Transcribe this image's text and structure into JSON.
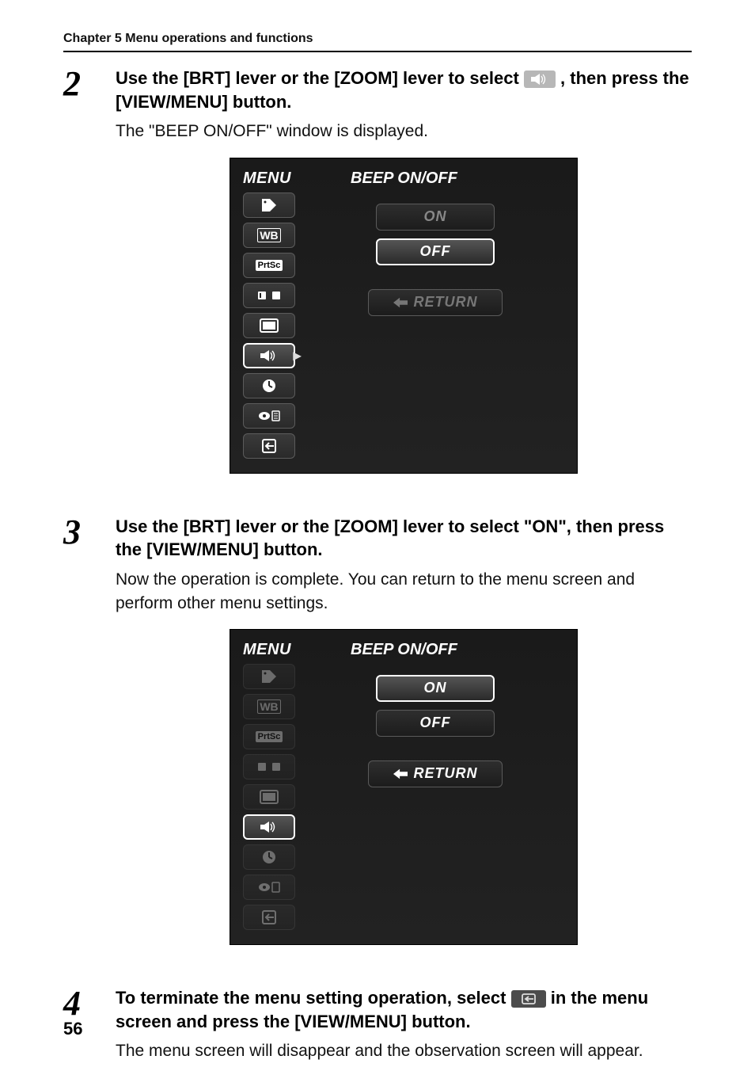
{
  "header": {
    "chapter": "Chapter 5 Menu operations and functions"
  },
  "steps": {
    "s2": {
      "num": "2",
      "title_before": "Use the [BRT] lever or the [ZOOM] lever to select ",
      "title_after": ", then press the [VIEW/MENU] button.",
      "desc": "The \"BEEP ON/OFF\" window is displayed."
    },
    "s3": {
      "num": "3",
      "title": "Use the [BRT] lever or the [ZOOM] lever to select \"ON\", then press the [VIEW/MENU] button.",
      "desc": "Now the operation is complete. You can return to the menu screen and perform other menu settings."
    },
    "s4": {
      "num": "4",
      "title_before": "To terminate the menu setting operation, select ",
      "title_after": " in the menu screen and press the [VIEW/MENU] button.",
      "desc": "The menu screen will disappear and the observation screen will appear."
    }
  },
  "screens": {
    "menu_label": "MENU",
    "title": "BEEP ON/OFF",
    "options": {
      "on": "ON",
      "off": "OFF",
      "return": "RETURN"
    }
  },
  "page_number": "56"
}
